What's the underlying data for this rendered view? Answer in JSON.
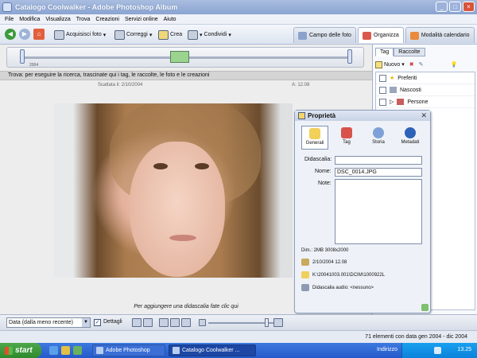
{
  "window": {
    "title": "Catalogo Coolwalker - Adobe Photoshop Album"
  },
  "menu": [
    "File",
    "Modifica",
    "Visualizza",
    "Trova",
    "Creazioni",
    "Servizi online",
    "Aiuto"
  ],
  "toolbar": {
    "acquisisci": "Acquisisci foto",
    "correggi": "Correggi",
    "crea": "Crea",
    "condividi": "Condividi"
  },
  "viewtabs": [
    "Campo delle foto",
    "Organizza",
    "Modalità calendario"
  ],
  "timeline": {
    "year": "2004"
  },
  "search_hint": "Trova: per eseguire la ricerca, trascinate qui i tag, le raccolte, le foto e le creazioni",
  "photo_info": {
    "taken": "Scattata il: 2/10/2004",
    "time": "A: 12.08"
  },
  "caption_hint": "Per aggiungere una didascalia fate clic qui",
  "properties": {
    "title": "Proprietà",
    "tabs": [
      "Generali",
      "Tag",
      "Storia",
      "Metadati"
    ],
    "labels": {
      "caption": "Didascalia:",
      "name": "Nome:",
      "notes": "Note:"
    },
    "name_value": "DSC_0014.JPG",
    "dimensions": "Dim.: 2MB  3008x2000",
    "date": "2/10/2004 12.08",
    "path": "K:\\20041003.001\\DCIM\\1000922L",
    "audio": "Didascalia audio:  <nessuno>"
  },
  "right_panel": {
    "tabs": [
      "Tag",
      "Raccolte"
    ],
    "new_label": "Nuovo",
    "items": [
      "Preferiti",
      "Nascosti",
      "Persone"
    ]
  },
  "bottom": {
    "sort": "Data (dalla meno recente)",
    "details": "Dettagli"
  },
  "status": "71 elementi con data gen 2004 - dic 2004",
  "taskbar": {
    "start": "start",
    "items": [
      "Adobe Photoshop",
      "Catalogo Coolwalker ..."
    ],
    "address": "Indirizzo",
    "clock": "13.25"
  }
}
